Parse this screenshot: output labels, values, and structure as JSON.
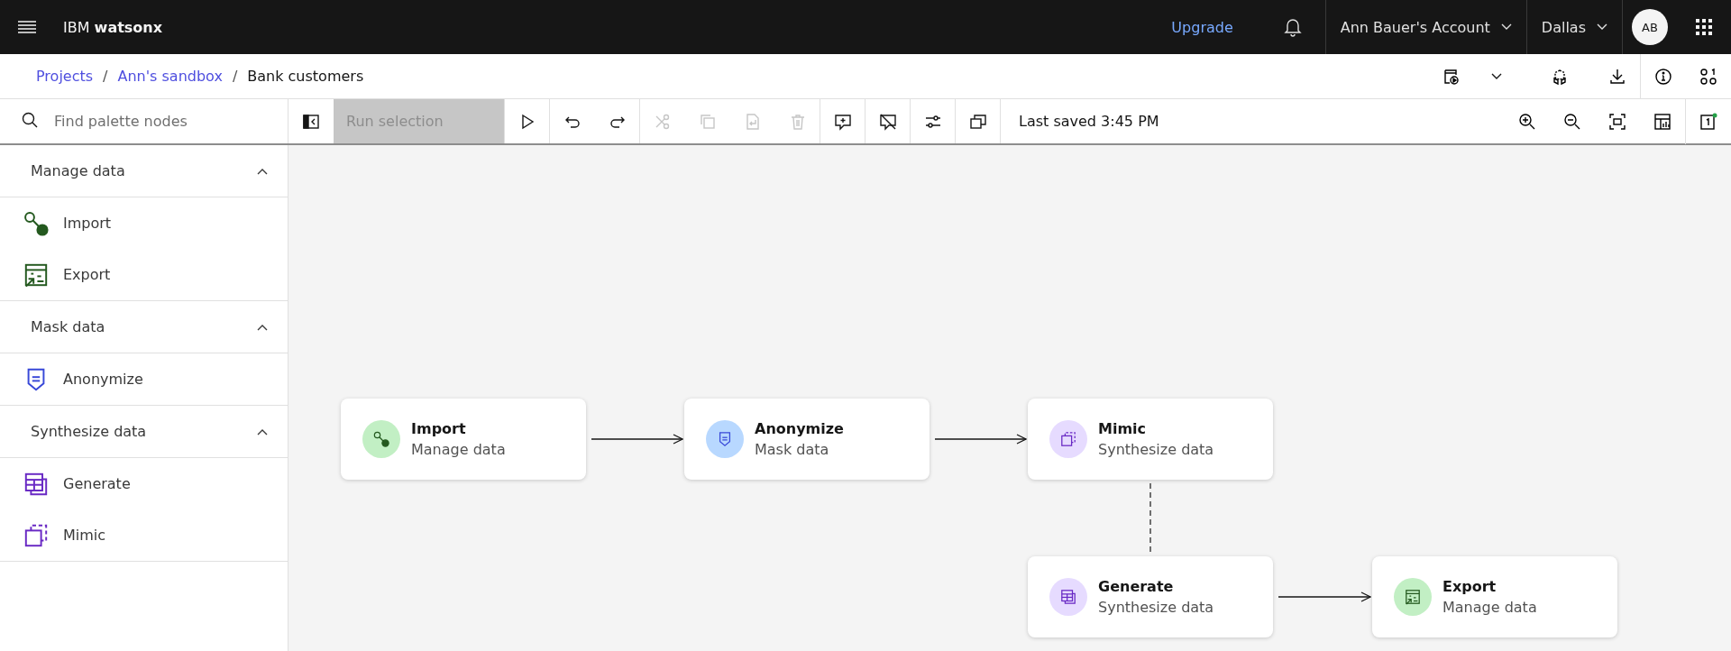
{
  "header": {
    "product": "IBM **watsonx**",
    "upgrade": "Upgrade",
    "account": "Ann Bauer's Account",
    "region": "Dallas",
    "avatar": "AB"
  },
  "breadcrumbs": [
    {
      "label": "Projects",
      "link": true,
      "separator": "/"
    },
    {
      "label": "Ann's sandbox",
      "link": true,
      "separator": "/"
    },
    {
      "label": "Bank customers",
      "link": false
    }
  ],
  "search": {
    "placeholder": "Find palette nodes"
  },
  "toolbar": [
    {
      "kind": "panel",
      "disabled": false
    },
    {
      "kind": "run-selection",
      "label": "Run selection",
      "disabled": true
    },
    {
      "kind": "run",
      "disabled": false
    },
    {
      "kind": "undo",
      "disabled": false
    },
    {
      "kind": "redo",
      "disabled": false
    },
    {
      "kind": "cut",
      "disabled": true
    },
    {
      "kind": "copy",
      "disabled": true
    },
    {
      "kind": "paste",
      "disabled": true
    },
    {
      "kind": "delete",
      "disabled": true
    },
    {
      "kind": "comment",
      "disabled": false
    },
    {
      "kind": "hide-comments",
      "disabled": false
    },
    {
      "kind": "settings",
      "disabled": false
    },
    {
      "kind": "windows",
      "disabled": false
    }
  ],
  "last_saved": "Last saved 3:45 PM",
  "palette": [
    {
      "title": "Manage data",
      "expanded": true,
      "items": [
        {
          "label": "Import",
          "kind": "import"
        },
        {
          "label": "Export",
          "kind": "export"
        }
      ]
    },
    {
      "title": "Mask data",
      "expanded": true,
      "items": [
        {
          "label": "Anonymize",
          "kind": "anonymize"
        }
      ]
    },
    {
      "title": "Synthesize data",
      "expanded": true,
      "items": [
        {
          "label": "Generate",
          "kind": "generate"
        },
        {
          "label": "Mimic",
          "kind": "mimic"
        }
      ]
    }
  ],
  "nodes": [
    {
      "title": "Import",
      "subtitle": "Manage data",
      "kind": "import",
      "color": "#c2efc4"
    },
    {
      "title": "Anonymize",
      "subtitle": "Mask data",
      "kind": "anonymize",
      "color": "#b8d8ff"
    },
    {
      "title": "Mimic",
      "subtitle": "Synthesize data",
      "kind": "mimic",
      "color": "#e6dbff"
    },
    {
      "title": "Generate",
      "subtitle": "Synthesize data",
      "kind": "generate",
      "color": "#e6dbff"
    },
    {
      "title": "Export",
      "subtitle": "Manage data",
      "kind": "export",
      "color": "#c2efc4"
    }
  ],
  "links": [
    {
      "kind": "arrow"
    },
    {
      "kind": "arrow"
    },
    {
      "kind": "dashed"
    },
    {
      "kind": "arrow"
    }
  ]
}
